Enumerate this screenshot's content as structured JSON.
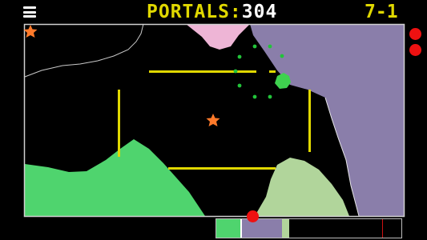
{
  "hud": {
    "menu_icon": "hamburger-menu-icon",
    "portals_label": "PORTALS:",
    "portals_value": "304",
    "level": "7-1"
  },
  "lives_remaining": 2,
  "colors": {
    "background": "#000000",
    "arena_border": "#d0d0d0",
    "portal_yellow": "#e0d800",
    "green_region": "#4fd46e",
    "pale_green_region": "#b1d59b",
    "lavender_region": "#8a7eaa",
    "pink_region": "#eeb5d6",
    "player_blob": "#3fd24f",
    "hazard_star": "#ff7a2a",
    "life_dot": "#ee1111"
  },
  "progress_bar": {
    "segments": [
      {
        "name": "green",
        "fraction": 0.13
      },
      {
        "name": "lavender",
        "fraction": 0.22
      },
      {
        "name": "pale-green",
        "fraction": 0.04
      }
    ],
    "marker_fraction": 0.89
  }
}
